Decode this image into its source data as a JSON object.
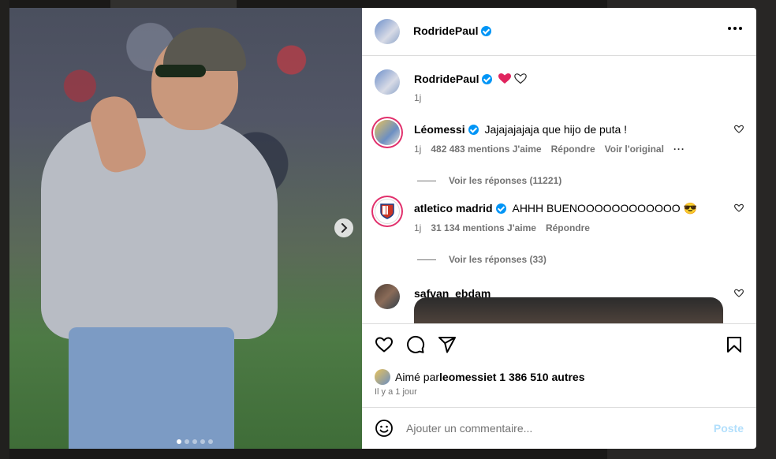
{
  "post": {
    "author": "RodridePaul",
    "verified": true,
    "caption_emojis": "❤️🤍",
    "caption_time": "1j",
    "media_dots": 5,
    "media_active_index": 0
  },
  "comments": [
    {
      "user": "Léomessi",
      "verified": true,
      "text": "Jajajajajaja que hijo de puta !",
      "time": "1j",
      "likes": "482 483 mentions J'aime",
      "reply_label": "Répondre",
      "translate_label": "Voir l'original",
      "replies_label": "Voir les réponses (11221)"
    },
    {
      "user": "atletico madrid",
      "verified": true,
      "text": "AHHH BUENOOOOOOOOOOOO 😎",
      "time": "1j",
      "likes": "31 134 mentions J'aime",
      "reply_label": "Répondre",
      "replies_label": "Voir les réponses (33)"
    },
    {
      "user": "safvan_ebdam",
      "verified": false
    }
  ],
  "engagement": {
    "liked_by_prefix": "Aimé par",
    "liked_by_user": "leomessi",
    "liked_by_suffix": "et 1 386 510 autres",
    "posted_ago": "Il y a 1 jour"
  },
  "comment_input": {
    "placeholder": "Ajouter un commentaire...",
    "post_label": "Poste"
  },
  "icons": [
    "next-arrow-icon",
    "more-options-icon",
    "heart-icon",
    "comment-icon",
    "share-icon",
    "bookmark-icon",
    "emoji-icon",
    "verified-badge-icon"
  ],
  "colors": {
    "verified_blue": "#0095f6",
    "post_button_disabled": "#b2dffc",
    "meta_gray": "#737373"
  }
}
